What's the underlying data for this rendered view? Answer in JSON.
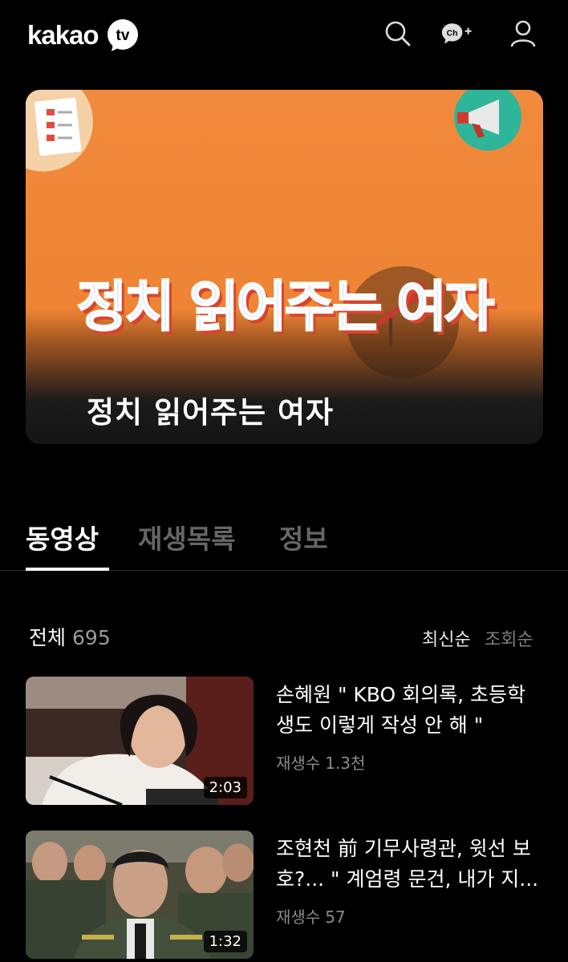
{
  "header": {
    "logo_text": "kakao",
    "logo_badge": "tv",
    "icons": [
      "search-icon",
      "channel-plus-icon",
      "user-icon"
    ],
    "channel_icon_text": "Ch+"
  },
  "banner": {
    "art_text": "정치 읽어주는 여자",
    "title": "정치 읽어주는 여자",
    "accent_color": "#f08a3c"
  },
  "tabs": [
    {
      "label": "동영상",
      "active": true
    },
    {
      "label": "재생목록",
      "active": false
    },
    {
      "label": "정보",
      "active": false
    }
  ],
  "list": {
    "label": "전체",
    "count": "695",
    "sort_options": [
      "최신순",
      "조회순"
    ],
    "selected_sort": "최신순"
  },
  "videos": [
    {
      "title": "손혜원  \" KBO 회의록, 초등학생도 이렇게 작성 안 해 \"",
      "views_label": "재생수",
      "views": "1.3천",
      "duration": "2:03"
    },
    {
      "title": "조현천 前 기무사령관, 윗선 보호?... \" 계엄령 문건, 내가 지...",
      "views_label": "재생수",
      "views": "57",
      "duration": "1:32"
    }
  ]
}
